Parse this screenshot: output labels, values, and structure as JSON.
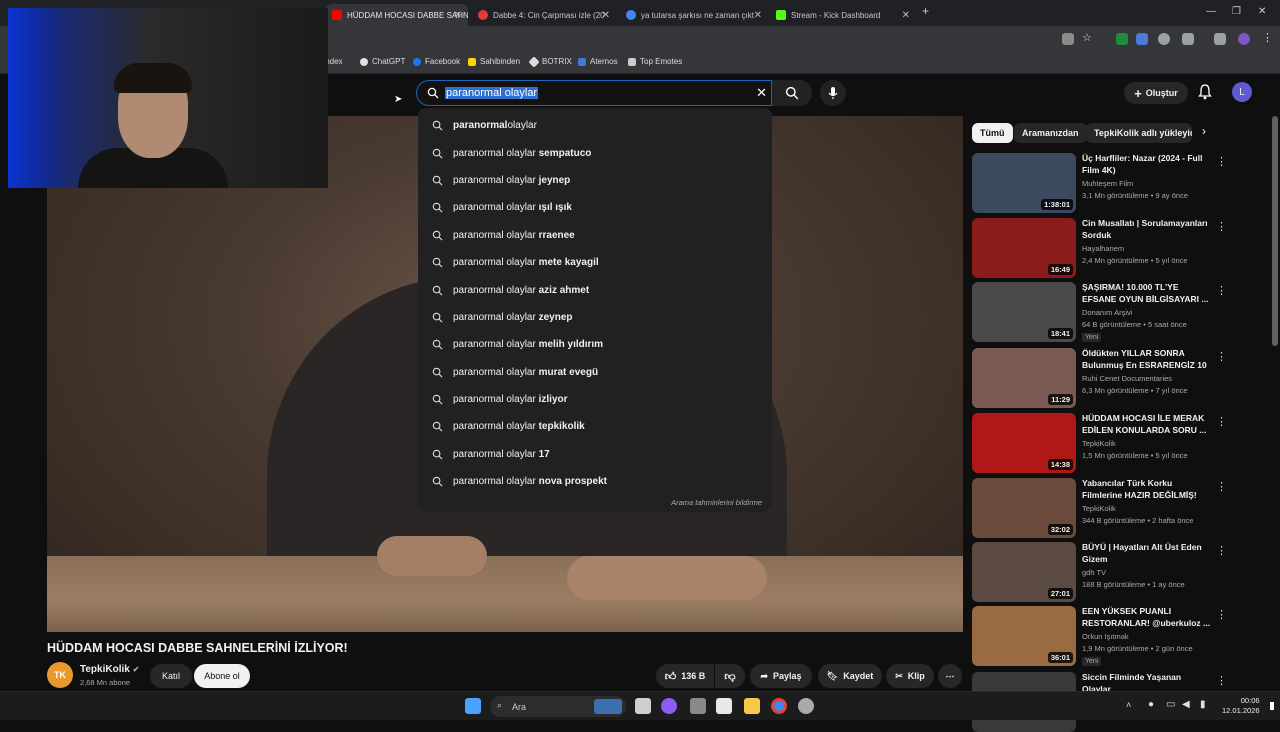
{
  "browser": {
    "tabs": [
      {
        "title": "HÜDDAM HOCASI DABBE SAHNE",
        "color": "#ff0000"
      },
      {
        "title": "Dabbe 4: Cin Çarpması izle (20",
        "color": "#e53935"
      },
      {
        "title": "ya tutarsa şarkısı ne zaman çıkt",
        "color": "#4285f4"
      },
      {
        "title": "Stream - Kick Dashboard",
        "color": "#53fc18"
      }
    ],
    "new_tab": "+",
    "bookmarks": [
      {
        "label": "Yandex",
        "color": "#ff3333"
      },
      {
        "label": "ChatGPT",
        "color": "#e0e0e0"
      },
      {
        "label": "Facebook",
        "color": "#1877f2"
      },
      {
        "label": "Sahibinden",
        "color": "#ffd400"
      },
      {
        "label": "BOTRIX",
        "color": "#dddddd"
      },
      {
        "label": "Aternos",
        "color": "#3a7bd5"
      },
      {
        "label": "Top Emotes",
        "color": "#cccccc"
      }
    ]
  },
  "header": {
    "search_query": "paranormal olaylar",
    "create_label": "Oluştur",
    "avatar_letter": "L"
  },
  "suggestions": {
    "base": "paranormal olaylar",
    "items": [
      {
        "base": "paranormal ",
        "rest": "olaylar",
        "prefix_bold": true
      },
      {
        "base": "paranormal olaylar",
        "rest": " sempatuco"
      },
      {
        "base": "paranormal olaylar",
        "rest": " jeynep"
      },
      {
        "base": "paranormal olaylar",
        "rest": " ışıl ışık"
      },
      {
        "base": "paranormal olaylar",
        "rest": " rraenee"
      },
      {
        "base": "paranormal olaylar",
        "rest": " mete kayagil"
      },
      {
        "base": "paranormal olaylar",
        "rest": " aziz ahmet"
      },
      {
        "base": "paranormal olaylar",
        "rest": " zeynep"
      },
      {
        "base": "paranormal olaylar",
        "rest": " melih yıldırım"
      },
      {
        "base": "paranormal olaylar",
        "rest": " murat evegü"
      },
      {
        "base": "paranormal olaylar",
        "rest": " izliyor"
      },
      {
        "base": "paranormal olaylar",
        "rest": " tepkikolik"
      },
      {
        "base": "paranormal olaylar",
        "rest": " 17"
      },
      {
        "base": "paranormal olaylar",
        "rest": " nova prospekt"
      }
    ],
    "footer": "Arama tahminlerini bildirme"
  },
  "video": {
    "title": "HÜDDAM HOCASI DABBE SAHNELERİNİ İZLİYOR!",
    "channel": "TepkiKolik",
    "channel_initials": "TK",
    "subscribers": "2,68 Mn abone",
    "join_label": "Katıl",
    "subscribe_label": "Abone ol",
    "likes": "136 B",
    "share_label": "Paylaş",
    "save_label": "Kaydet",
    "clip_label": "Klip"
  },
  "chips": [
    "Tümü",
    "Aramanızdan",
    "TepkiKolik adlı yükleyici"
  ],
  "recommendations": [
    {
      "title": "Üç Harfliler: Nazar (2024 - Full Film 4K)",
      "channel": "Muhteşem Film",
      "meta": "3,1 Mn görüntüleme • 9 ay önce",
      "duration": "1:38:01",
      "badge": "",
      "thumb": "#3b4a5e"
    },
    {
      "title": "Cin Musallatı | Sorulamayanları Sorduk",
      "channel": "Hayalhanem",
      "meta": "2,4 Mn görüntüleme • 5 yıl önce",
      "duration": "16:49",
      "badge": "",
      "thumb": "#8a1c1c"
    },
    {
      "title": "ŞAŞIRMA! 10.000 TL'YE EFSANE OYUN BİLGİSAYARI ...",
      "channel": "Donanım Arşivi",
      "meta": "64 B görüntüleme • 5 saat önce",
      "duration": "18:41",
      "badge": "Yeni",
      "thumb": "#4a4a4a"
    },
    {
      "title": "Öldükten YILLAR SONRA Bulunmuş En ESRARENGİZ 10 ...",
      "channel": "Ruhi Cenet Documentaries",
      "meta": "6,3 Mn görüntüleme • 7 yıl önce",
      "duration": "11:29",
      "badge": "",
      "thumb": "#7a5a52"
    },
    {
      "title": "HÜDDAM HOCASI İLE MERAK EDİLEN KONULARDA SORU ...",
      "channel": "TepkiKolik",
      "meta": "1,5 Mn görüntüleme • 5 yıl önce",
      "duration": "14:38",
      "badge": "",
      "thumb": "#b01818"
    },
    {
      "title": "Yabancılar Türk Korku Filmlerine HAZIR DEĞİLMİŞ!",
      "channel": "TepkiKolik",
      "meta": "344 B görüntüleme • 2 hafta önce",
      "duration": "32:02",
      "badge": "",
      "thumb": "#6a4a3a"
    },
    {
      "title": "BÜYÜ | Hayatları Alt Üst Eden Gizem",
      "channel": "gdh TV",
      "meta": "188 B görüntüleme • 1 ay önce",
      "duration": "27:01",
      "badge": "",
      "thumb": "#5a4a42"
    },
    {
      "title": "EEN YÜKSEK PUANLI RESTORANLAR! @uberkuloz ...",
      "channel": "Orkun Işıtmak",
      "meta": "1,9 Mn görüntüleme • 2 gün önce",
      "duration": "36:01",
      "badge": "Yeni",
      "thumb": "#9a6a42"
    },
    {
      "title": "Siccin Filminde Yaşanan Olaylar",
      "channel": "",
      "meta": "",
      "duration": "",
      "badge": "",
      "thumb": "#3a3a3a"
    }
  ],
  "taskbar": {
    "search_label": "Ara",
    "time": "00:06",
    "date": "12.01.2026"
  },
  "colors": {
    "accent": "#1c62b9",
    "bg": "#0f0f0f"
  }
}
